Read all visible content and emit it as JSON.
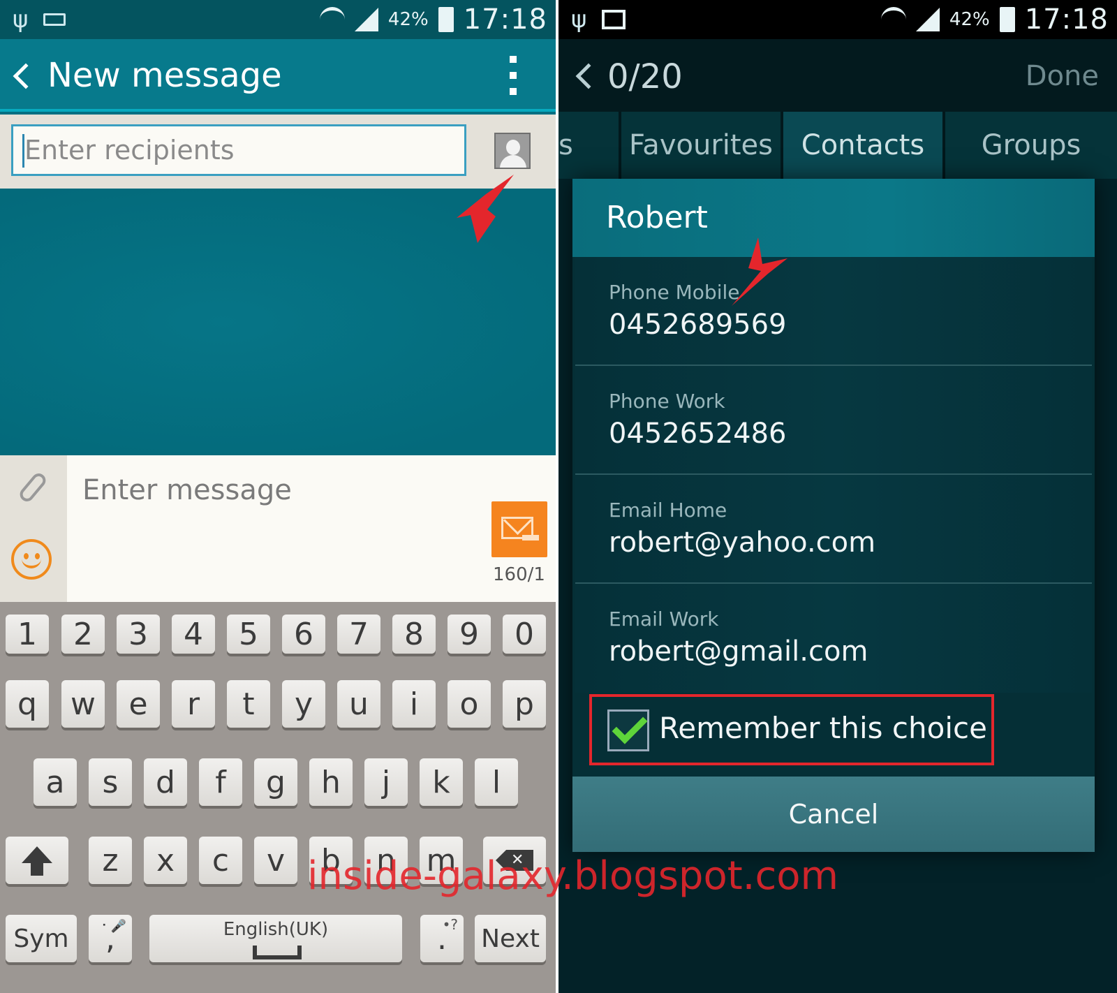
{
  "left_screen": {
    "status": {
      "battery": "42%",
      "time": "17:18"
    },
    "appbar": {
      "title": "New message"
    },
    "recipients": {
      "placeholder": "Enter recipients"
    },
    "compose": {
      "placeholder": "Enter message",
      "char_count": "160/1"
    },
    "keyboard": {
      "number_row": [
        "1",
        "2",
        "3",
        "4",
        "5",
        "6",
        "7",
        "8",
        "9",
        "0"
      ],
      "row1": [
        "q",
        "w",
        "e",
        "r",
        "t",
        "y",
        "u",
        "i",
        "o",
        "p"
      ],
      "row2": [
        "a",
        "s",
        "d",
        "f",
        "g",
        "h",
        "j",
        "k",
        "l"
      ],
      "row3": [
        "z",
        "x",
        "c",
        "v",
        "b",
        "n",
        "m"
      ],
      "sym_label": "Sym",
      "comma_label": ",",
      "space_label": "English(UK)",
      "period_label": ".",
      "period_sub": "•?",
      "next_label": "Next"
    }
  },
  "right_screen": {
    "status": {
      "battery": "42%",
      "time": "17:18"
    },
    "appbar": {
      "counter": "0/20",
      "done_label": "Done"
    },
    "tabs": [
      {
        "label": "s",
        "active": false
      },
      {
        "label": "Favourites",
        "active": false
      },
      {
        "label": "Contacts",
        "active": true
      },
      {
        "label": "Groups",
        "active": false
      }
    ],
    "dialog": {
      "title": "Robert",
      "options": [
        {
          "label": "Phone Mobile",
          "value": "0452689569"
        },
        {
          "label": "Phone Work",
          "value": "0452652486"
        },
        {
          "label": "Email Home",
          "value": "robert@yahoo.com"
        },
        {
          "label": "Email Work",
          "value": "robert@gmail.com"
        }
      ],
      "remember_label": "Remember this choice",
      "remember_checked": true,
      "cancel_label": "Cancel"
    }
  },
  "watermark": "inside-galaxy.blogspot.com",
  "colors": {
    "accent": "#046f82",
    "annotation_red": "#e4262c",
    "send_orange": "#f5841f",
    "check_green": "#5fd43a"
  }
}
